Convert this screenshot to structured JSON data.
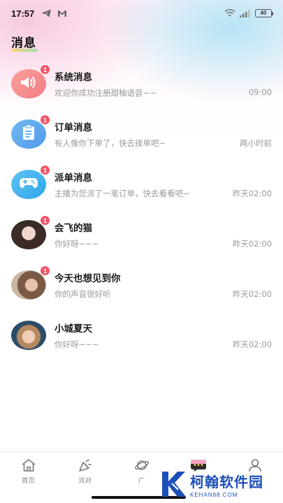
{
  "status": {
    "time": "17:57",
    "battery": "40"
  },
  "page": {
    "title": "消息"
  },
  "messages": [
    {
      "name": "系统消息",
      "preview": "欢迎你成功注册甜柚语音~~",
      "time": "09:00",
      "badge": "1",
      "avatar": "speaker-icon"
    },
    {
      "name": "订单消息",
      "preview": "有人像你下单了，快去接单吧~",
      "time": "两小时前",
      "badge": "1",
      "avatar": "clipboard-icon"
    },
    {
      "name": "派单消息",
      "preview": "主播为您派了一笔订单，快去看看吧~",
      "time": "昨天02:00",
      "badge": "1",
      "avatar": "gamepad-icon"
    },
    {
      "name": "会飞的猫",
      "preview": "你好呀~~~",
      "time": "昨天02:00",
      "badge": "1",
      "avatar": "user-photo"
    },
    {
      "name": "今天也想见到你",
      "preview": "你的声音很好听",
      "time": "昨天02:00",
      "badge": "1",
      "avatar": "user-photo"
    },
    {
      "name": "小城夏天",
      "preview": "你好呀~~~",
      "time": "昨天02:00",
      "badge": "",
      "avatar": "user-photo"
    }
  ],
  "nav": [
    {
      "label": "首页",
      "icon": "home-icon"
    },
    {
      "label": "派对",
      "icon": "party-icon"
    },
    {
      "label": "广",
      "icon": "planet-icon"
    },
    {
      "label": "",
      "icon": "message-icon"
    },
    {
      "label": "",
      "icon": "profile-icon"
    }
  ],
  "watermark": {
    "title": "柯翰软件园",
    "subtitle": "KEHAN88.COM"
  },
  "colors": {
    "badge": "#f0556a",
    "system_avatar": "#f58a86",
    "order_avatar": "#5aa8ee",
    "dispatch_avatar": "#3fb2ee",
    "watermark": "#1d4fb8"
  }
}
